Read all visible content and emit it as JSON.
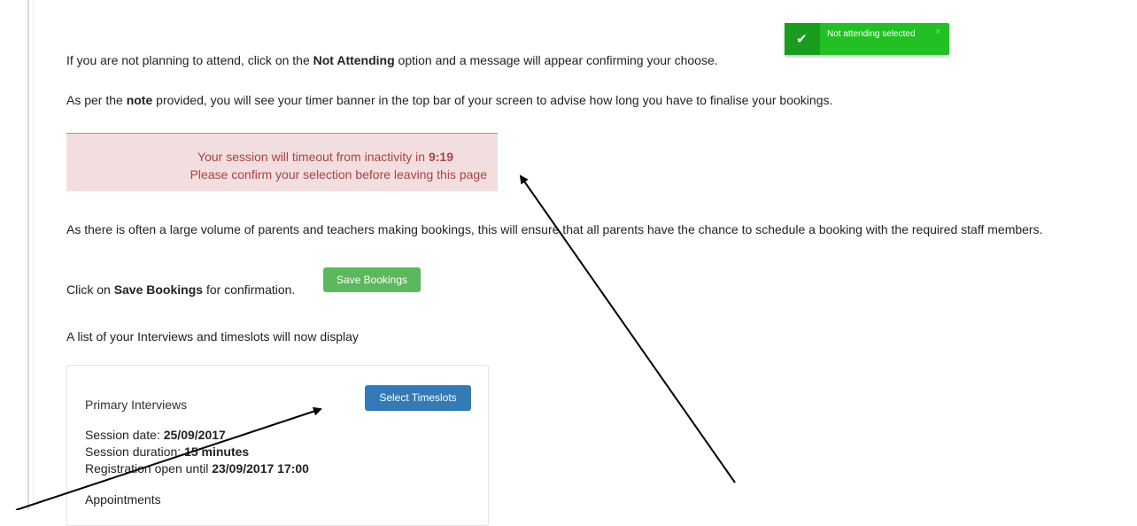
{
  "toast": {
    "message": "Not attending selected",
    "close": "×"
  },
  "p1": {
    "before": "If you are not planning  to attend, click on the ",
    "bold": "Not Attending",
    "after": " option and a message will appear confirming your choose."
  },
  "p2": {
    "before": "As per the ",
    "bold": "note",
    "after": " provided, you will see your timer banner in the top bar of your screen to advise how long you have to finalise your bookings."
  },
  "timeout": {
    "line1_prefix": "Your session will timeout from inactivity in ",
    "time": "9:19",
    "line2": "Please confirm your selection before leaving this page"
  },
  "p3": "As there is often a large volume of parents and teachers making bookings, this will ensure that all parents have the chance to schedule a booking with the required staff members.",
  "p4": {
    "before": "Click on ",
    "bold": "Save Bookings",
    "after": " for confirmation."
  },
  "save_button": "Save Bookings",
  "p5": "A list of your Interviews and timeslots will now display",
  "card": {
    "title": "Primary Interviews",
    "select_button": "Select Timeslots",
    "date_label": "Session date: ",
    "date_value": "25/09/2017",
    "duration_label": "Session duration: ",
    "duration_value": "15 minutes",
    "reg_label": "Registration open until ",
    "reg_value": "23/09/2017 17:00",
    "appointments": "Appointments"
  }
}
